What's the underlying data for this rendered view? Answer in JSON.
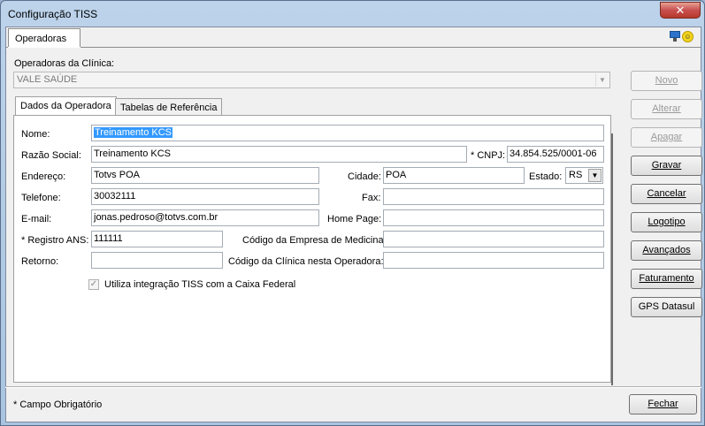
{
  "window": {
    "title": "Configuração TISS",
    "close_glyph": "✕"
  },
  "top_tabs": [
    {
      "label": "Operadoras"
    }
  ],
  "icons": {
    "monitor": "monitor-icon",
    "smile": "smile-icon"
  },
  "operadoras_label": "Operadoras da Clínica:",
  "operadora_selected": "VALE SAÚDE",
  "inner_tabs": [
    {
      "label": "Dados da Operadora"
    },
    {
      "label": "Tabelas de Referência"
    }
  ],
  "form": {
    "nome_label": "Nome:",
    "nome": "Treinamento KCS",
    "razao_label": "Razão Social:",
    "razao": "Treinamento KCS",
    "cnpj_label": "* CNPJ:",
    "cnpj": "34.854.525/0001-06",
    "endereco_label": "Endereço:",
    "endereco": "Totvs POA",
    "cidade_label": "Cidade:",
    "cidade": "POA",
    "estado_label": "Estado:",
    "estado": "RS",
    "telefone_label": "Telefone:",
    "telefone": "30032111",
    "fax_label": "Fax:",
    "fax": "",
    "email_label": "E-mail:",
    "email": "jonas.pedroso@totvs.com.br",
    "homepage_label": "Home Page:",
    "homepage": "",
    "registro_label": "* Registro ANS:",
    "registro": "111111",
    "cod_empresa_label": "Código da Empresa de Medicina:",
    "cod_empresa": "",
    "retorno_label": "Retorno:",
    "retorno": "",
    "cod_clinica_label": "Código da Clínica nesta Operadora:",
    "cod_clinica": "",
    "caixa_label": "Utiliza integração TISS com a Caixa Federal",
    "caixa_checked": true
  },
  "buttons": {
    "novo": "Novo",
    "alterar": "Alterar",
    "apagar": "Apagar",
    "gravar": "Gravar",
    "cancelar": "Cancelar",
    "logotipo": "Logotipo",
    "avancados": "Avançados",
    "faturamento": "Faturamento",
    "gps": "GPS Datasul",
    "fechar": "Fechar"
  },
  "footer_note": "* Campo Obrigatório"
}
